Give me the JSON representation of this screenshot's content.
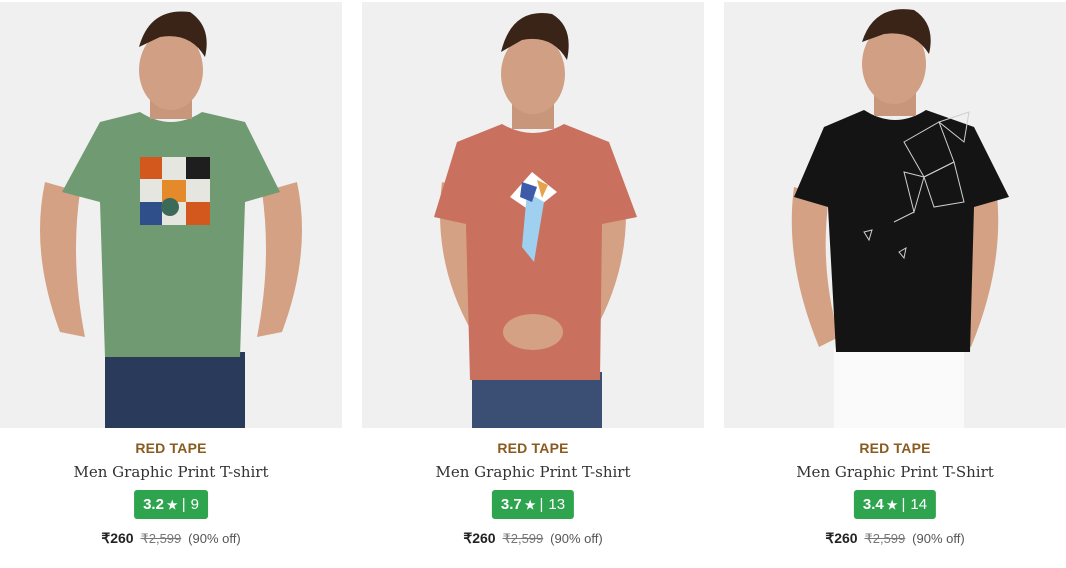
{
  "products": [
    {
      "brand": "RED TAPE",
      "title": "Men Graphic Print T-shirt",
      "rating": "3.2",
      "rating_count": "9",
      "price": "₹260",
      "mrp": "₹2,599",
      "discount": "(90% off)",
      "shirt_color": "#6f9a72"
    },
    {
      "brand": "RED TAPE",
      "title": "Men Graphic Print T-shirt",
      "rating": "3.7",
      "rating_count": "13",
      "price": "₹260",
      "mrp": "₹2,599",
      "discount": "(90% off)",
      "shirt_color": "#c9705f"
    },
    {
      "brand": "RED TAPE",
      "title": "Men Graphic Print T-Shirt",
      "rating": "3.4",
      "rating_count": "14",
      "price": "₹260",
      "mrp": "₹2,599",
      "discount": "(90% off)",
      "shirt_color": "#141414"
    }
  ],
  "colors": {
    "brand_text": "#8a5a1e",
    "rating_badge": "#2ea44f"
  },
  "icons": {
    "rating_star": "star-icon"
  }
}
